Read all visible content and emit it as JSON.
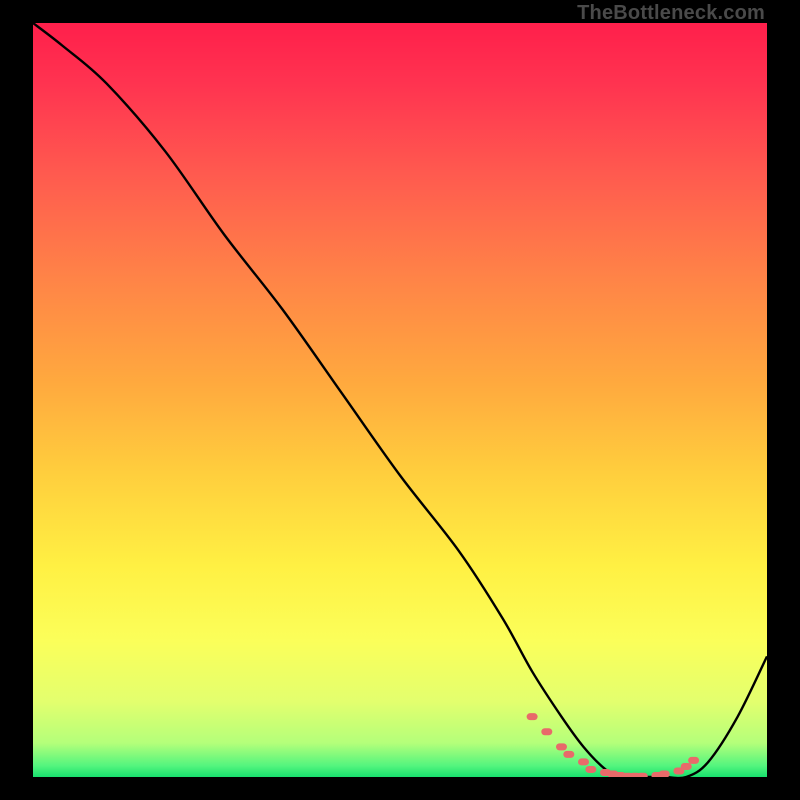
{
  "watermark": "TheBottleneck.com",
  "chart_data": {
    "type": "line",
    "title": "",
    "xlabel": "",
    "ylabel": "",
    "xlim": [
      0,
      100
    ],
    "ylim": [
      0,
      100
    ],
    "series": [
      {
        "name": "bottleneck-curve",
        "x": [
          0,
          4,
          10,
          18,
          26,
          34,
          42,
          50,
          58,
          64,
          68,
          72,
          75,
          78,
          80,
          83,
          86,
          89,
          92,
          96,
          100
        ],
        "y": [
          100,
          97,
          92,
          83,
          72,
          62,
          51,
          40,
          30,
          21,
          14,
          8,
          4,
          1,
          0,
          0,
          0,
          0,
          2,
          8,
          16
        ],
        "color": "#000000"
      },
      {
        "name": "optimal-markers",
        "type_override": "scatter",
        "x": [
          68,
          70,
          72,
          73,
          75,
          76,
          78,
          79,
          80,
          81,
          82,
          83,
          85,
          86,
          88,
          89,
          90
        ],
        "y": [
          8,
          6,
          4,
          3,
          2,
          1,
          0.6,
          0.4,
          0.2,
          0.1,
          0.1,
          0.1,
          0.2,
          0.4,
          0.8,
          1.4,
          2.2
        ],
        "color": "#e86a6a"
      }
    ],
    "gradient_stops": [
      {
        "offset": 0.0,
        "color": "#ff1f4b"
      },
      {
        "offset": 0.08,
        "color": "#ff3350"
      },
      {
        "offset": 0.2,
        "color": "#ff5a4f"
      },
      {
        "offset": 0.34,
        "color": "#ff8447"
      },
      {
        "offset": 0.48,
        "color": "#ffaa3e"
      },
      {
        "offset": 0.6,
        "color": "#ffcf3d"
      },
      {
        "offset": 0.72,
        "color": "#fff043"
      },
      {
        "offset": 0.82,
        "color": "#fbff5a"
      },
      {
        "offset": 0.9,
        "color": "#e3ff6e"
      },
      {
        "offset": 0.955,
        "color": "#b4ff7a"
      },
      {
        "offset": 0.985,
        "color": "#54f57e"
      },
      {
        "offset": 1.0,
        "color": "#18e06e"
      }
    ]
  }
}
